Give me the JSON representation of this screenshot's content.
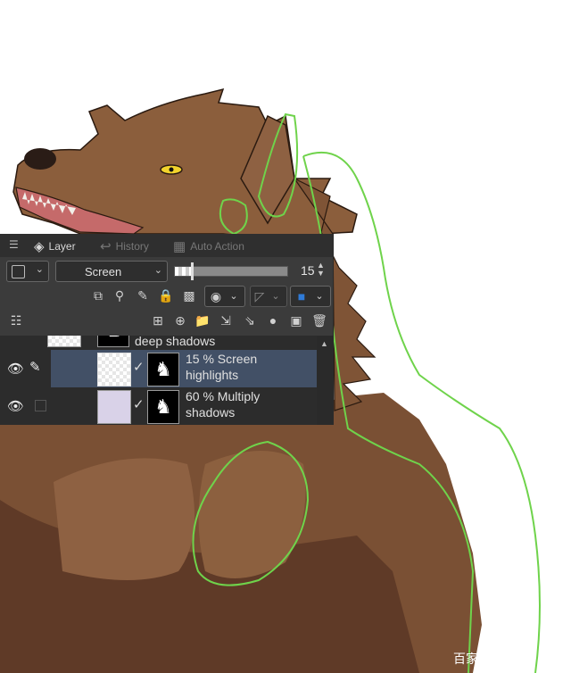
{
  "tabs": [
    {
      "label": "Layer",
      "active": true
    },
    {
      "label": "History",
      "active": false
    },
    {
      "label": "Auto Action",
      "active": false
    }
  ],
  "blend_mode": "Screen",
  "opacity": 15,
  "opacity_fraction": 0.15,
  "layers": [
    {
      "label_line1": "deep shadows",
      "label_line2": "",
      "selected": false
    },
    {
      "label_line1": "15 % Screen",
      "label_line2": "highlights",
      "selected": true
    },
    {
      "label_line1": "60 % Multiply",
      "label_line2": "shadows",
      "selected": false
    }
  ],
  "watermark": "百家",
  "colors": {
    "fur": "#8b5e3c",
    "fur_dark": "#5d3a26",
    "guide_line": "#6fd34b",
    "panel_bg": "#3b3b3b",
    "selection": "#425066",
    "accent_blue": "#2f7bd8"
  }
}
